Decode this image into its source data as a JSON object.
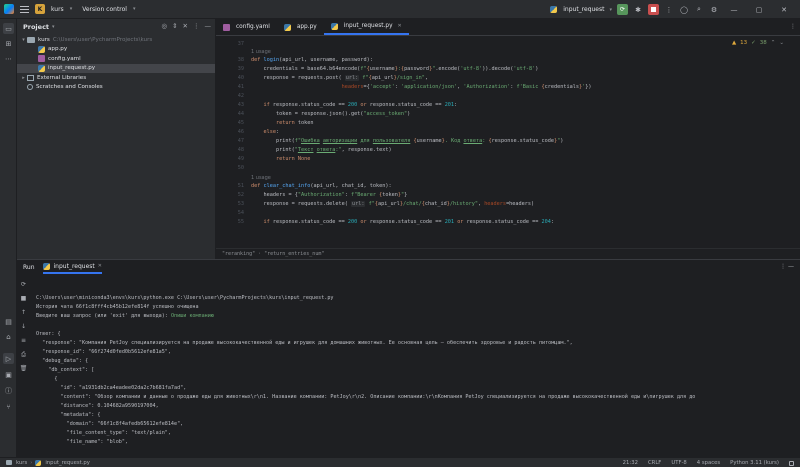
{
  "titlebar": {
    "project_badge": "K",
    "project_name": "kurs",
    "vcs": "Version control",
    "run_config": "input_request"
  },
  "toolstrip": {
    "items": [
      "folder-icon",
      "structure-icon",
      "more-icon",
      "python-console-icon",
      "run-icon",
      "terminal-icon",
      "problems-icon",
      "git-icon"
    ]
  },
  "project": {
    "title": "Project",
    "tree": {
      "root_name": "kurs",
      "root_path": "C:\\Users\\user\\PycharmProjects\\kurs",
      "files": [
        "app.py",
        "config.yaml",
        "input_request.py"
      ],
      "external": "External Libraries",
      "scratches": "Scratches and Consoles"
    }
  },
  "editor": {
    "tabs": [
      {
        "label": "config.yaml",
        "icon": "yaml"
      },
      {
        "label": "app.py",
        "icon": "python"
      },
      {
        "label": "input_request.py",
        "icon": "python"
      }
    ],
    "warnings": "13",
    "weak_warnings": "38",
    "usage": "1 usage",
    "lines": {
      "l37": "37",
      "l38": "38",
      "l39": "39",
      "l40": "40",
      "l41": "41",
      "l42": "42",
      "l43": "43",
      "l44": "44",
      "l45": "45",
      "l46": "46",
      "l47": "47",
      "l48": "48",
      "l49": "49",
      "l50": "50",
      "l51": "51",
      "l52": "52",
      "l53": "53",
      "l54": "54",
      "l55": "55"
    },
    "breadcrumb": "\"reranking\" · \"return_entries_num\""
  },
  "run": {
    "title": "Run",
    "tab": "input_request",
    "console": {
      "cmd": "C:\\Users\\user\\miniconda3\\envs\\kurs\\python.exe C:\\Users\\user\\PycharmProjects\\kurs\\input_request.py",
      "history": "История чата 66f1c8fff4cb45b12efe814f успешно очищена",
      "prompt": "Введите ваш запрос (или 'exit' для выхода): ",
      "input": "Опиши компанию",
      "answer": "Ответ: {",
      "response_line": "  \"response\": \"Компания PetJoy специализируется на продаже высококачественной еды и игрушек для домашних животных. Ее основная цель — обеспечить здоровье и радость питомцам.\",",
      "response_id": "  \"response_id\": \"66f274d0fed0b5612efe81a5\",",
      "debug_data": "  \"debug_data\": {",
      "db_context": "    \"db_context\": [",
      "brace": "      {",
      "id": "        \"id\": \"a1931db2ca4eadee02da2c7b681fa7ad\",",
      "content": "        \"content\": \"Обзор компании и данные о продаже еды для животных\\r\\n1. Название компании: PetJoy\\r\\n2. Описание компании:\\r\\nКомпания PetJoy специализируется на продаже высококачественной еды и\\nигрушек для до",
      "distance": "        \"distance\": 0.104682a9590197004,",
      "metadata": "        \"metadata\": {",
      "domain": "          \"domain\": \"66f1c8f4afedb65612efe814e\",",
      "file_content_type": "          \"file_content_type\": \"text/plain\",",
      "file_name": "          \"file_name\": \"blob\","
    }
  },
  "status": {
    "project": "kurs",
    "file": "input_request.py",
    "position": "21:32",
    "line_sep": "CRLF",
    "encoding": "UTF-8",
    "indent": "4 spaces",
    "interpreter": "Python 3.11 (kurs)"
  }
}
